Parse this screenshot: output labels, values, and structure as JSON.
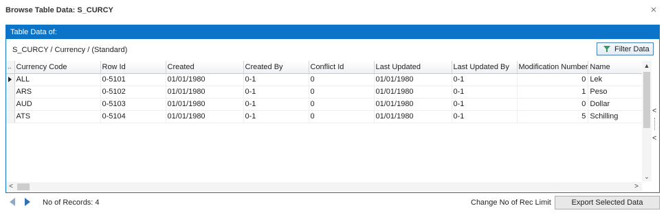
{
  "window": {
    "title": "Browse Table Data: S_CURCY",
    "close_symbol": "×"
  },
  "panel": {
    "header": "Table Data of:",
    "subtitle": "S_CURCY / Currency / (Standard)",
    "filter_button": "Filter Data"
  },
  "grid": {
    "columns": [
      "Currency Code",
      "Row Id",
      "Created",
      "Created By",
      "Conflict Id",
      "Last Updated",
      "Last Updated By",
      "Modification Number",
      "Name"
    ],
    "rows": [
      [
        "ALL",
        "0-5101",
        "01/01/1980",
        "0-1",
        "0",
        "01/01/1980",
        "0-1",
        "0",
        "Lek"
      ],
      [
        "ARS",
        "0-5102",
        "01/01/1980",
        "0-1",
        "0",
        "01/01/1980",
        "0-1",
        "1",
        "Peso"
      ],
      [
        "AUD",
        "0-5103",
        "01/01/1980",
        "0-1",
        "0",
        "01/01/1980",
        "0-1",
        "0",
        "Dollar"
      ],
      [
        "ATS",
        "0-5104",
        "01/01/1980",
        "0-1",
        "0",
        "01/01/1980",
        "0-1",
        "5",
        "Schilling"
      ]
    ],
    "selected_row": 0,
    "scroll_symbols": {
      "up": "▲",
      "down": "⌄",
      "left": "<",
      "right": ">"
    },
    "side_handle_symbols": [
      "<",
      "<"
    ]
  },
  "footer": {
    "records": "No of Records: 4",
    "change_limit": "Change No of Rec Limit",
    "export_button": "Export Selected Data"
  },
  "colors": {
    "accent": "#0b74c9",
    "filter_icon": "#2d9b5a"
  }
}
